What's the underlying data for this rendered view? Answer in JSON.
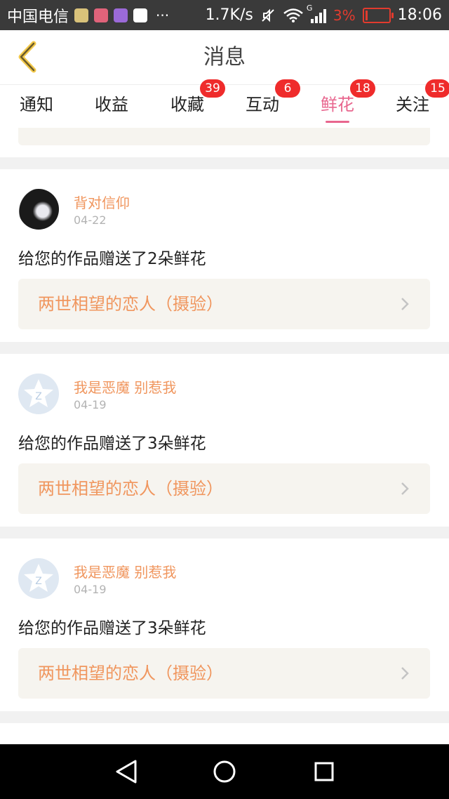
{
  "status_bar": {
    "carrier": "中国电信",
    "dots": "···",
    "speed": "1.7K/s",
    "signal_tag": "G",
    "battery_pct": "3%",
    "time": "18:06",
    "icons": [
      "app-icon-1",
      "app-icon-2",
      "app-icon-3",
      "youku-icon",
      "mute-icon",
      "wifi-icon",
      "signal-icon",
      "battery-icon"
    ]
  },
  "header": {
    "title": "消息",
    "back_icon": "chevron-left-icon"
  },
  "tabs": [
    {
      "label": "通知",
      "badge": ""
    },
    {
      "label": "收益",
      "badge": ""
    },
    {
      "label": "收藏",
      "badge": "39"
    },
    {
      "label": "互动",
      "badge": "6"
    },
    {
      "label": "鲜花",
      "badge": "18",
      "active": true
    },
    {
      "label": "关注",
      "badge": "15"
    }
  ],
  "messages": [
    {
      "username": "背对信仰",
      "date": "04-22",
      "text": "给您的作品赠送了2朵鲜花",
      "work_title": "两世相望的恋人（摄验）",
      "avatar": "ink-avatar"
    },
    {
      "username": "我是恶魔 别惹我",
      "date": "04-19",
      "text": "给您的作品赠送了3朵鲜花",
      "work_title": "两世相望的恋人（摄验）",
      "avatar": "default-avatar"
    },
    {
      "username": "我是恶魔 别惹我",
      "date": "04-19",
      "text": "给您的作品赠送了3朵鲜花",
      "work_title": "两世相望的恋人（摄验）",
      "avatar": "default-avatar"
    }
  ],
  "colors": {
    "accent_pink": "#e8668e",
    "username_orange": "#f0965e",
    "badge_red": "#ef2b2b",
    "card_bg": "#f6f4ef"
  }
}
